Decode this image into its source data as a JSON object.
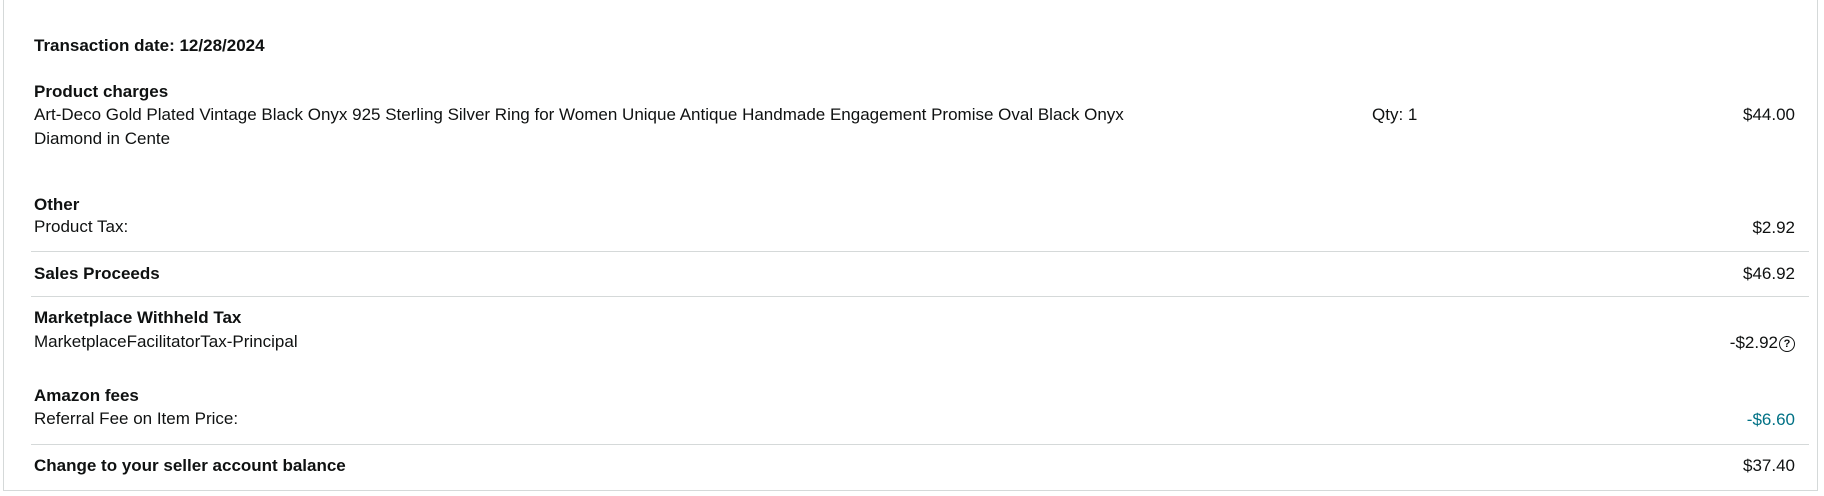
{
  "transaction": {
    "date_label": "Transaction date: 12/28/2024"
  },
  "product_charges": {
    "heading": "Product charges",
    "description": "Art-Deco Gold Plated Vintage Black Onyx 925 Sterling Silver Ring for Women Unique Antique Handmade Engagement Promise Oval Black Onyx Diamond in Cente",
    "qty": "Qty: 1",
    "amount": "$44.00"
  },
  "other": {
    "heading": "Other",
    "line_label": "Product Tax:",
    "amount": "$2.92"
  },
  "sales_proceeds": {
    "label": "Sales Proceeds",
    "amount": "$46.92"
  },
  "marketplace_withheld_tax": {
    "heading": "Marketplace Withheld Tax",
    "line_label": "MarketplaceFacilitatorTax-Principal",
    "amount": "-$2.92",
    "icon": "help-circle-icon"
  },
  "amazon_fees": {
    "heading": "Amazon fees",
    "line_label": "Referral Fee on Item Price:",
    "amount": "-$6.60",
    "amount_color": "#007185"
  },
  "balance_change": {
    "label": "Change to your seller account balance",
    "amount": "$37.40"
  }
}
